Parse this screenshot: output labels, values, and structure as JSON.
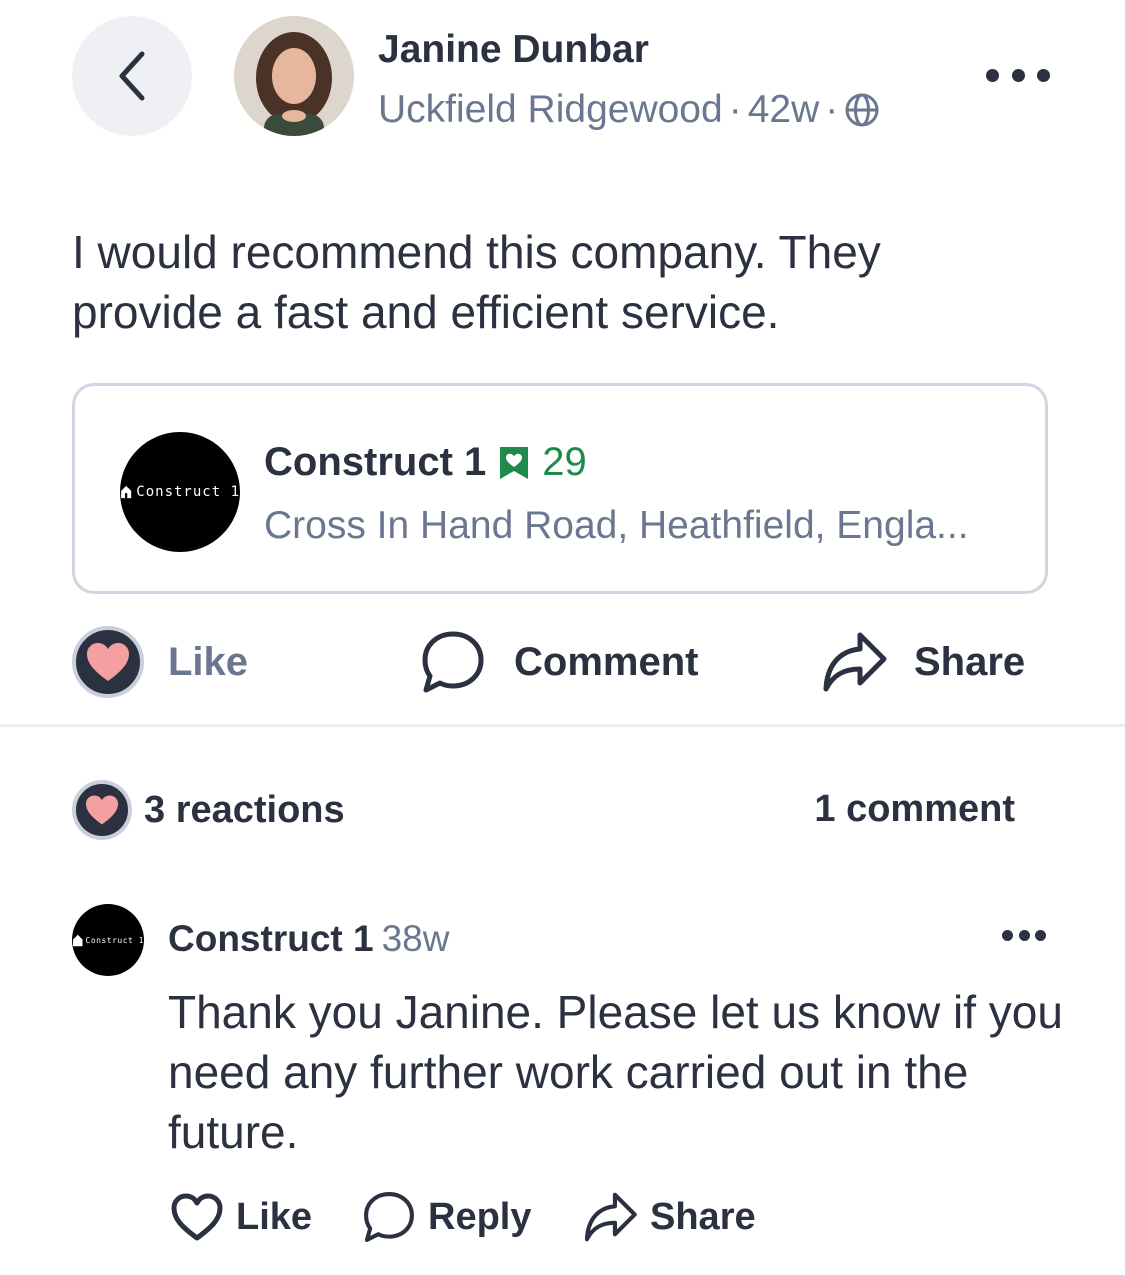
{
  "post": {
    "author_name": "Janine Dunbar",
    "author_location": "Uckfield Ridgewood",
    "author_time": "42w",
    "meta_separator": "·",
    "visibility_icon": "globe-icon",
    "text": "I would recommend this company. They provide a fast and efficient service."
  },
  "business": {
    "name": "Construct 1",
    "badge_icon": "favorite-badge-icon",
    "recommend_count": "29",
    "address": "Cross In Hand Road, Heathfield,  Engla...",
    "logo_text": "Construct 1"
  },
  "actions": {
    "like_label": "Like",
    "comment_label": "Comment",
    "share_label": "Share"
  },
  "stats": {
    "reactions": "3 reactions",
    "comments": "1 comment"
  },
  "comment": {
    "author": "Construct 1",
    "time": "38w",
    "text": "Thank you Janine. Please let us know if you need any further work carried out in the future.",
    "like_label": "Like",
    "reply_label": "Reply",
    "share_label": "Share",
    "logo_text": "Construct 1"
  },
  "colors": {
    "text_primary": "#2b3140",
    "text_secondary": "#6b7690",
    "accent_green": "#1f8a4c",
    "heart_pink": "#f4a0a0",
    "border": "#cfd5e2"
  }
}
